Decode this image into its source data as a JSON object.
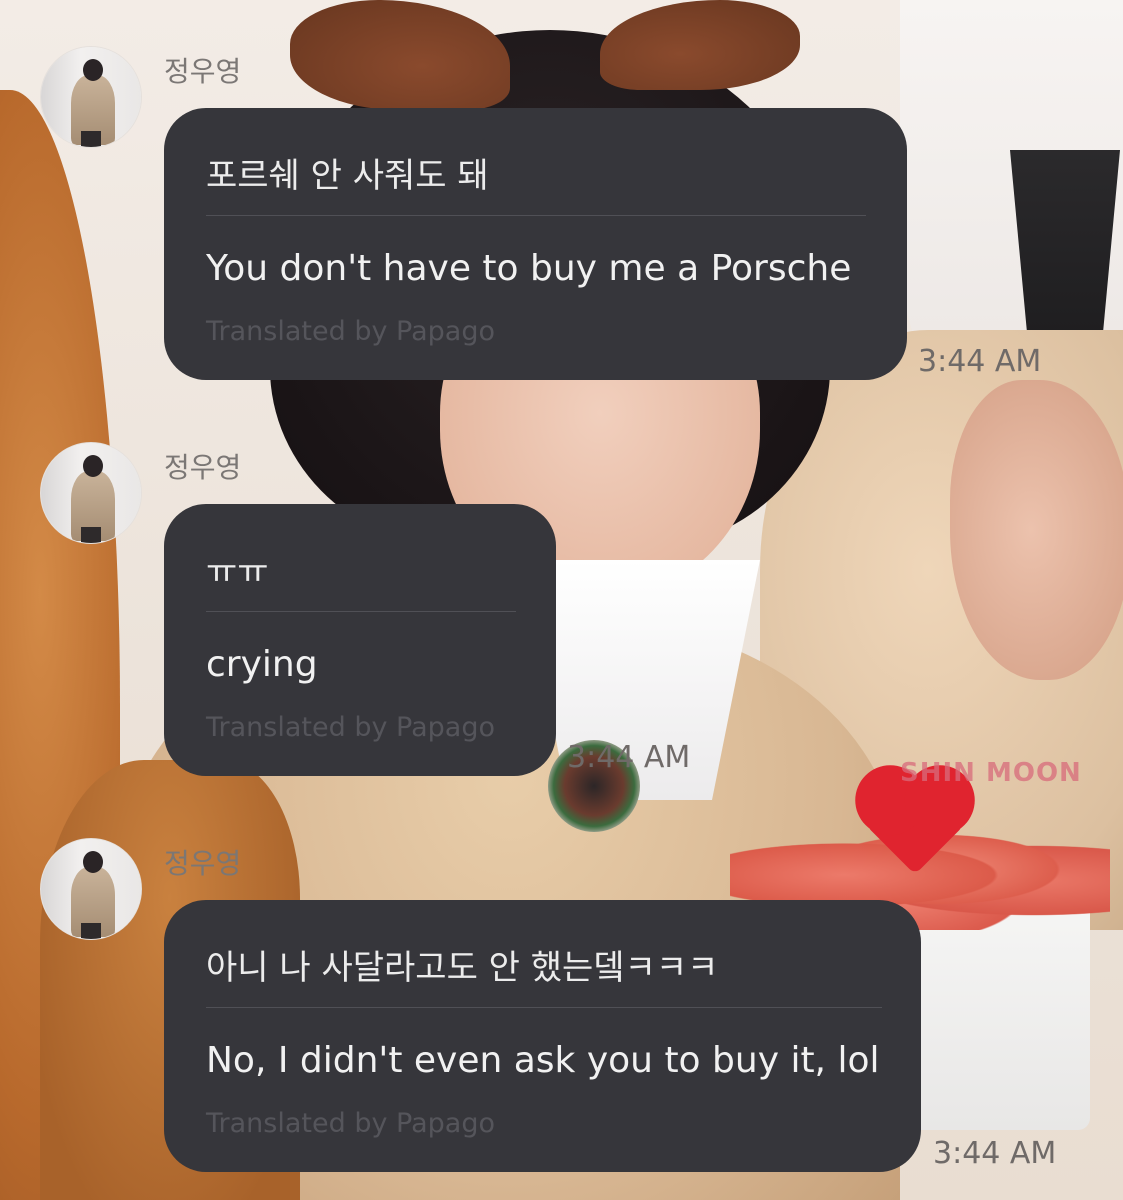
{
  "chat": {
    "messages": [
      {
        "sender": "정우영",
        "original": "포르쉐 안 사줘도 돼",
        "translated": "You don't have to buy me a Porsche",
        "credit": "Translated by Papago",
        "time": "3:44 AM"
      },
      {
        "sender": "정우영",
        "original": "ㅠㅠ",
        "translated": "crying",
        "credit": "Translated by Papago",
        "time": "3:44 AM"
      },
      {
        "sender": "정우영",
        "original": "아니 나 사달라고도 안 했는뎈ㅋㅋㅋ",
        "translated": "No, I didn't even ask you to buy it, lol",
        "credit": "Translated by Papago",
        "time": "3:44 AM"
      }
    ]
  },
  "background": {
    "sign_text": "SHIN MOON"
  }
}
